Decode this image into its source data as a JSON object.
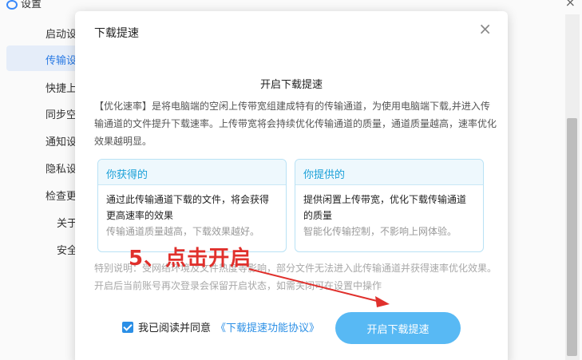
{
  "background": {
    "window_title": "设置",
    "close_symbol": "×",
    "sidebar": {
      "items": [
        {
          "label": "启动设",
          "active": false
        },
        {
          "label": "传输设",
          "active": true
        },
        {
          "label": "快捷上",
          "active": false
        },
        {
          "label": "同步空",
          "active": false
        },
        {
          "label": "通知设",
          "active": false
        },
        {
          "label": "隐私设",
          "active": false
        },
        {
          "label": "检查更",
          "active": false
        }
      ],
      "sub_items": [
        {
          "label": "关于"
        },
        {
          "label": "安全"
        }
      ]
    }
  },
  "dialog": {
    "title": "下载提速",
    "close_symbol": "×",
    "heading": "开启下载提速",
    "description": "【优化速率】是将电脑端的空闲上传带宽组建成特有的传输通道，为使用电脑端下载,并进入传输通道的文件提升下载速率。上传带宽将会持续优化传输通道的质量，通道质量越高，速率优化效果越明显。",
    "cards": [
      {
        "title": "你获得的",
        "main": "通过此传输通道下载的文件，将会获得更高速率的效果",
        "sub": "传输通道质量越高，下载效果越好。"
      },
      {
        "title": "你提供的",
        "main": "提供闲置上传带宽，优化下载传输通道的质量",
        "sub": "智能化传输控制，不影响上网体验。"
      }
    ],
    "note": "特别说明：受网络环境及文件热度等影响，部分文件无法进入此传输通道并获得速率优化效果。开启后当前账号再次登录会保留开启状态，如需关闭可在设置中操作",
    "agree_text": "我已阅读并同意",
    "agree_link": "《下载提速功能协议》",
    "agree_checked": true,
    "primary_button": "开启下载提速"
  },
  "annotation": {
    "text": "5、点击开启",
    "color": "#e0302c"
  },
  "colors": {
    "accent": "#2b8fe6",
    "button": "#58b9f4",
    "card_title": "#1aa0d8"
  }
}
